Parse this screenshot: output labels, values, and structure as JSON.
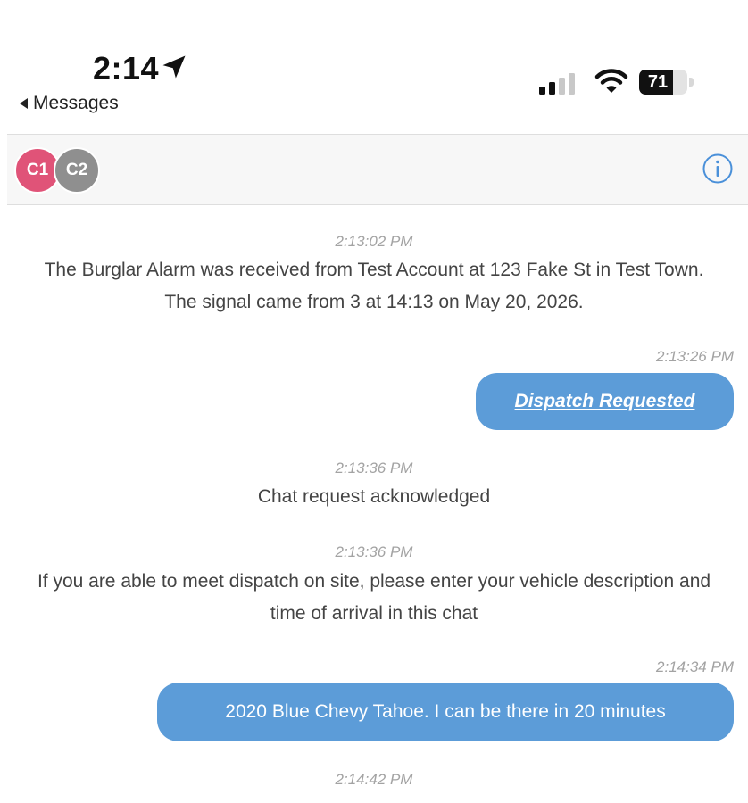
{
  "status_bar": {
    "time": "2:14",
    "back_label": "Messages",
    "battery_level": "71",
    "location_icon": "location-arrow-icon",
    "signal_icon": "cellular-signal-icon",
    "wifi_icon": "wifi-icon"
  },
  "header": {
    "avatars": [
      {
        "initials": "C1",
        "color": "#e05378"
      },
      {
        "initials": "C2",
        "color": "#8f8f8f"
      }
    ],
    "info_icon": "info-icon"
  },
  "messages": [
    {
      "type": "system",
      "time": "2:13:02 PM",
      "text": "The Burglar Alarm  was received from Test Account at 123 Fake St  in Test Town. The signal came from 3  at 14:13 on May 20, 2026."
    },
    {
      "type": "outgoing",
      "time": "2:13:26 PM",
      "text": "Dispatch Requested",
      "link": true
    },
    {
      "type": "system",
      "time": "2:13:36 PM",
      "text": "Chat request acknowledged"
    },
    {
      "type": "system",
      "time": "2:13:36 PM",
      "text": "If you are able to meet dispatch on site, please enter your vehicle description and time of arrival in this chat"
    },
    {
      "type": "outgoing",
      "time": "2:14:34 PM",
      "text": "2020  Blue Chevy Tahoe. I can be there in 20 minutes"
    },
    {
      "type": "system",
      "time": "2:14:42 PM",
      "text": ""
    }
  ],
  "colors": {
    "bubble": "#5c9cd8",
    "timestamp": "#a3a3a3",
    "header_bg": "#f7f7f7",
    "info_accent": "#4a90d9"
  }
}
